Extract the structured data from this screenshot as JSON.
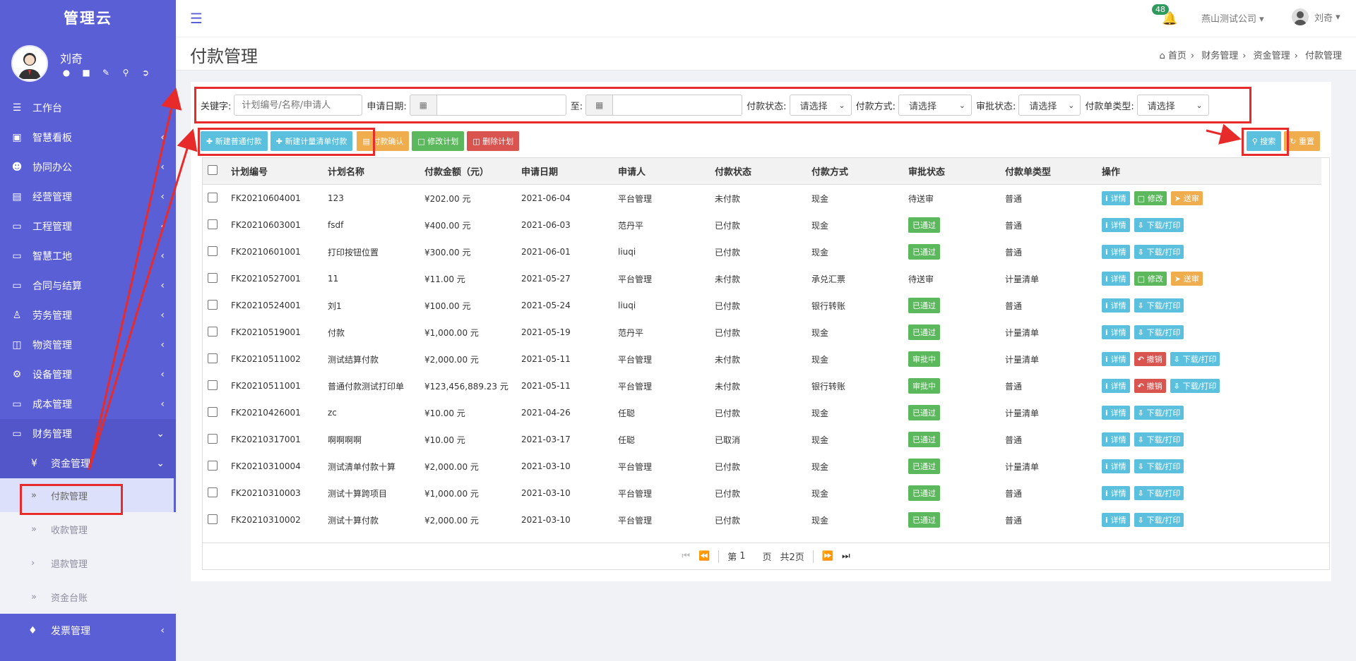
{
  "sidebar": {
    "brand": "管理云",
    "user": "刘奇",
    "menu": [
      {
        "label": "工作台"
      },
      {
        "label": "智慧看板"
      },
      {
        "label": "协同办公"
      },
      {
        "label": "经营管理"
      },
      {
        "label": "工程管理"
      },
      {
        "label": "智慧工地"
      },
      {
        "label": "合同与结算"
      },
      {
        "label": "劳务管理"
      },
      {
        "label": "物资管理"
      },
      {
        "label": "设备管理"
      },
      {
        "label": "成本管理"
      },
      {
        "label": "财务管理"
      }
    ],
    "submenu": {
      "label": "资金管理",
      "icon": "¥"
    },
    "subitems": [
      {
        "label": "付款管理"
      },
      {
        "label": "收款管理"
      },
      {
        "label": "退款管理"
      },
      {
        "label": "资金台账"
      }
    ],
    "invoice": {
      "label": "发票管理"
    }
  },
  "topbar": {
    "notifications": "48",
    "company": "燕山测试公司",
    "user": "刘奇"
  },
  "page": {
    "title": "付款管理",
    "breadcrumb": [
      "首页",
      "财务管理",
      "资金管理",
      "付款管理"
    ]
  },
  "filter": {
    "keyword_label": "关键字:",
    "keyword_placeholder": "计划编号/名称/申请人",
    "date_label": "申请日期:",
    "to_label": "至:",
    "pay_status_label": "付款状态:",
    "pay_method_label": "付款方式:",
    "approval_label": "审批状态:",
    "type_label": "付款单类型:",
    "select_placeholder": "请选择"
  },
  "actions": {
    "new_normal": "新建普通付款",
    "new_measure": "新建计量清单付款",
    "confirm": "付款确认",
    "edit_plan": "修改计划",
    "delete_plan": "删除计划",
    "search": "搜索",
    "reset": "重置"
  },
  "table": {
    "headers": [
      "计划编号",
      "计划名称",
      "付款金额（元）",
      "申请日期",
      "申请人",
      "付款状态",
      "付款方式",
      "审批状态",
      "付款单类型",
      "操作"
    ],
    "rows": [
      {
        "code": "FK20210604001",
        "name": "123",
        "amount": "¥202.00 元",
        "date": "2021-06-04",
        "applicant": "平台管理",
        "pay_status": "未付款",
        "method": "现金",
        "approval": "待送审",
        "type": "普通",
        "ops": [
          "详情",
          "修改",
          "送审"
        ]
      },
      {
        "code": "FK20210603001",
        "name": "fsdf",
        "amount": "¥400.00 元",
        "date": "2021-06-03",
        "applicant": "范丹平",
        "pay_status": "已付款",
        "method": "现金",
        "approval": "已通过",
        "type": "普通",
        "ops": [
          "详情",
          "下载/打印"
        ]
      },
      {
        "code": "FK20210601001",
        "name": "打印按钮位置",
        "amount": "¥300.00 元",
        "date": "2021-06-01",
        "applicant": "liuqi",
        "pay_status": "已付款",
        "method": "现金",
        "approval": "已通过",
        "type": "普通",
        "ops": [
          "详情",
          "下载/打印"
        ]
      },
      {
        "code": "FK20210527001",
        "name": "11",
        "amount": "¥11.00 元",
        "date": "2021-05-27",
        "applicant": "平台管理",
        "pay_status": "未付款",
        "method": "承兑汇票",
        "approval": "待送审",
        "type": "计量清单",
        "ops": [
          "详情",
          "修改",
          "送审"
        ]
      },
      {
        "code": "FK20210524001",
        "name": "刘1",
        "amount": "¥100.00 元",
        "date": "2021-05-24",
        "applicant": "liuqi",
        "pay_status": "已付款",
        "method": "银行转账",
        "approval": "已通过",
        "type": "普通",
        "ops": [
          "详情",
          "下载/打印"
        ]
      },
      {
        "code": "FK20210519001",
        "name": "付款",
        "amount": "¥1,000.00 元",
        "date": "2021-05-19",
        "applicant": "范丹平",
        "pay_status": "已付款",
        "method": "现金",
        "approval": "已通过",
        "type": "计量清单",
        "ops": [
          "详情",
          "下载/打印"
        ]
      },
      {
        "code": "FK20210511002",
        "name": "测试结算付款",
        "amount": "¥2,000.00 元",
        "date": "2021-05-11",
        "applicant": "平台管理",
        "pay_status": "未付款",
        "method": "现金",
        "approval": "审批中",
        "type": "计量清单",
        "ops": [
          "详情",
          "撤销",
          "下载/打印"
        ]
      },
      {
        "code": "FK20210511001",
        "name": "普通付款测试打印单",
        "amount": "¥123,456,889.23 元",
        "date": "2021-05-11",
        "applicant": "平台管理",
        "pay_status": "未付款",
        "method": "银行转账",
        "approval": "审批中",
        "type": "普通",
        "ops": [
          "详情",
          "撤销",
          "下载/打印"
        ]
      },
      {
        "code": "FK20210426001",
        "name": "zc",
        "amount": "¥10.00 元",
        "date": "2021-04-26",
        "applicant": "任聪",
        "pay_status": "已付款",
        "method": "现金",
        "approval": "已通过",
        "type": "计量清单",
        "ops": [
          "详情",
          "下载/打印"
        ]
      },
      {
        "code": "FK20210317001",
        "name": "啊啊啊啊",
        "amount": "¥10.00 元",
        "date": "2021-03-17",
        "applicant": "任聪",
        "pay_status": "已取消",
        "method": "现金",
        "approval": "已通过",
        "type": "普通",
        "ops": [
          "详情",
          "下载/打印"
        ]
      },
      {
        "code": "FK20210310004",
        "name": "测试清单付款十算",
        "amount": "¥2,000.00 元",
        "date": "2021-03-10",
        "applicant": "平台管理",
        "pay_status": "已付款",
        "method": "现金",
        "approval": "已通过",
        "type": "计量清单",
        "ops": [
          "详情",
          "下载/打印"
        ]
      },
      {
        "code": "FK20210310003",
        "name": "测试十算跨项目",
        "amount": "¥1,000.00 元",
        "date": "2021-03-10",
        "applicant": "平台管理",
        "pay_status": "已付款",
        "method": "现金",
        "approval": "已通过",
        "type": "普通",
        "ops": [
          "详情",
          "下载/打印"
        ]
      },
      {
        "code": "FK20210310002",
        "name": "测试十算付款",
        "amount": "¥2,000.00 元",
        "date": "2021-03-10",
        "applicant": "平台管理",
        "pay_status": "已付款",
        "method": "现金",
        "approval": "已通过",
        "type": "普通",
        "ops": [
          "详情",
          "下载/打印"
        ]
      }
    ]
  },
  "pager": {
    "page_prefix": "第",
    "page_num": "1",
    "page_suffix": "页",
    "total": "共2页"
  },
  "colors": {
    "sidebar": "#5b5fd6",
    "info": "#5bc0de",
    "warning": "#f0ad4e",
    "success": "#5cb85c",
    "danger": "#d9534f",
    "annotation": "#e72b2b"
  }
}
